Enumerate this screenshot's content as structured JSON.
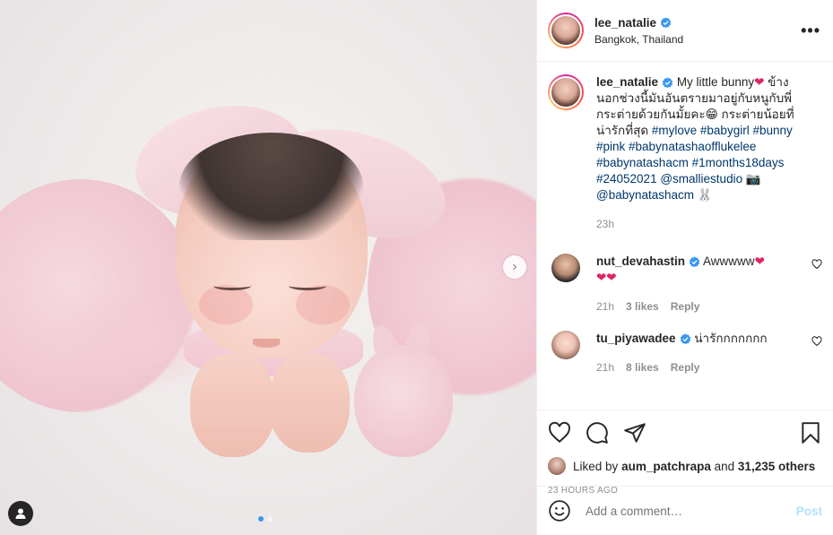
{
  "header": {
    "username": "lee_natalie",
    "location": "Bangkok, Thailand",
    "more_label": "•••"
  },
  "caption": {
    "username": "lee_natalie",
    "text_1": "My little bunny",
    "heart_emoji": "❤",
    "text_2": " ข้างนอกช่วงนี้มันอันตรายมาอยู่กับหนูกับพี่กระต่ายด้วยกันมั้ยคะ",
    "grin_emoji": "😁",
    "text_3": " กระต่ายน้อยที่น่ารักที่สุด ",
    "hashtags_1": "#mylove #babygirl #bunny #pink #babynatashaofflukelee #babynatashacm #1months18days #24052021",
    "mention_1": "@smalliestudio",
    "camera_emoji": "📷",
    "mention_2": "@babynatashacm",
    "rabbit_emoji": "🐰",
    "time": "23h"
  },
  "comments": [
    {
      "username": "nut_devahastin",
      "text": "Awwwww",
      "hearts": "❤",
      "hearts_line2": "❤❤",
      "time": "21h",
      "likes": "3 likes",
      "reply": "Reply"
    },
    {
      "username": "tu_piyawadee",
      "text": "น่ารักกกกกกก",
      "time": "21h",
      "likes": "8 likes",
      "reply": "Reply"
    }
  ],
  "likes": {
    "prefix": "Liked by ",
    "user": "aum_patchrapa",
    "middle": " and ",
    "count": "31,235 others"
  },
  "timestamp": "23 HOURS AGO",
  "add_comment": {
    "placeholder": "Add a comment…",
    "post_label": "Post"
  },
  "carousel": {
    "current": 1,
    "total": 2,
    "next_label": "›"
  },
  "colors": {
    "verified": "#3897f0",
    "link": "#00376b",
    "muted": "#8e8e8e",
    "post_disabled": "#b2dffc",
    "heart": "#e0245e"
  }
}
